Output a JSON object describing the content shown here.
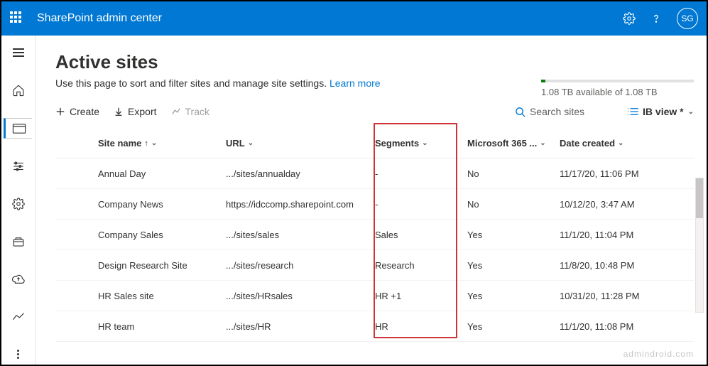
{
  "header": {
    "brand": "SharePoint admin center",
    "avatar": "SG"
  },
  "page": {
    "title": "Active sites",
    "subtitle": "Use this page to sort and filter sites and manage site settings. ",
    "learn_more": "Learn more"
  },
  "storage": {
    "text": "1.08 TB available of 1.08 TB"
  },
  "toolbar": {
    "create": "Create",
    "export": "Export",
    "track": "Track",
    "search_placeholder": "Search sites",
    "view": "IB view *"
  },
  "columns": {
    "site": "Site name",
    "url": "URL",
    "segments": "Segments",
    "m365": "Microsoft 365 ...",
    "date": "Date created"
  },
  "rows": [
    {
      "site": "Annual Day",
      "url": ".../sites/annualday",
      "segments": "-",
      "m365": "No",
      "date": "11/17/20, 11:06 PM"
    },
    {
      "site": "Company News",
      "url": "https://idccomp.sharepoint.com",
      "segments": "-",
      "m365": "No",
      "date": "10/12/20, 3:47 AM"
    },
    {
      "site": "Company Sales",
      "url": ".../sites/sales",
      "segments": "Sales",
      "m365": "Yes",
      "date": "11/1/20, 11:04 PM"
    },
    {
      "site": "Design Research Site",
      "url": ".../sites/research",
      "segments": "Research",
      "m365": "Yes",
      "date": "11/8/20, 10:48 PM"
    },
    {
      "site": "HR Sales site",
      "url": ".../sites/HRsales",
      "segments": "HR +1",
      "m365": "Yes",
      "date": "10/31/20, 11:28 PM"
    },
    {
      "site": "HR team",
      "url": ".../sites/HR",
      "segments": "HR",
      "m365": "Yes",
      "date": "11/1/20, 11:08 PM"
    }
  ],
  "watermark": "admindroid.com"
}
